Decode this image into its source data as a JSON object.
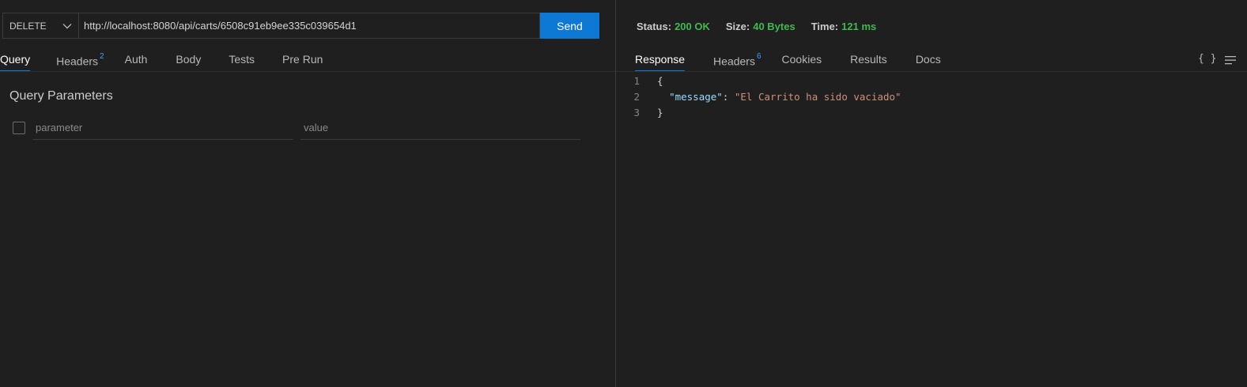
{
  "request": {
    "method": "DELETE",
    "url": "http://localhost:8080/api/carts/6508c91eb9ee335c039654d1",
    "send_label": "Send"
  },
  "request_tabs": [
    {
      "label": "Query",
      "badge": ""
    },
    {
      "label": "Headers",
      "badge": "2"
    },
    {
      "label": "Auth",
      "badge": ""
    },
    {
      "label": "Body",
      "badge": ""
    },
    {
      "label": "Tests",
      "badge": ""
    },
    {
      "label": "Pre Run",
      "badge": ""
    }
  ],
  "active_request_tab": "Query",
  "query": {
    "title": "Query Parameters",
    "param_placeholder": "parameter",
    "value_placeholder": "value"
  },
  "status_bar": {
    "status_key": "Status:",
    "status_val": "200 OK",
    "size_key": "Size:",
    "size_val": "40 Bytes",
    "time_key": "Time:",
    "time_val": "121 ms"
  },
  "response_tabs": [
    {
      "label": "Response",
      "badge": ""
    },
    {
      "label": "Headers",
      "badge": "6"
    },
    {
      "label": "Cookies",
      "badge": ""
    },
    {
      "label": "Results",
      "badge": ""
    },
    {
      "label": "Docs",
      "badge": ""
    }
  ],
  "active_response_tab": "Response",
  "toolbar": {
    "format_label": "{ }",
    "icons": [
      "braces-icon",
      "menu-lines-icon"
    ]
  },
  "response_body": {
    "line_numbers": [
      "1",
      "2",
      "3"
    ],
    "open_brace": "{",
    "key": "\"message\"",
    "colon": ": ",
    "value": "\"El Carrito ha sido vaciado\"",
    "close_brace": "}"
  },
  "colors": {
    "accent": "#0e78d5",
    "status_ok": "#3fb950",
    "json_key": "#9cdcfe",
    "json_string": "#ce9178",
    "badge": "#3aa0ff"
  }
}
